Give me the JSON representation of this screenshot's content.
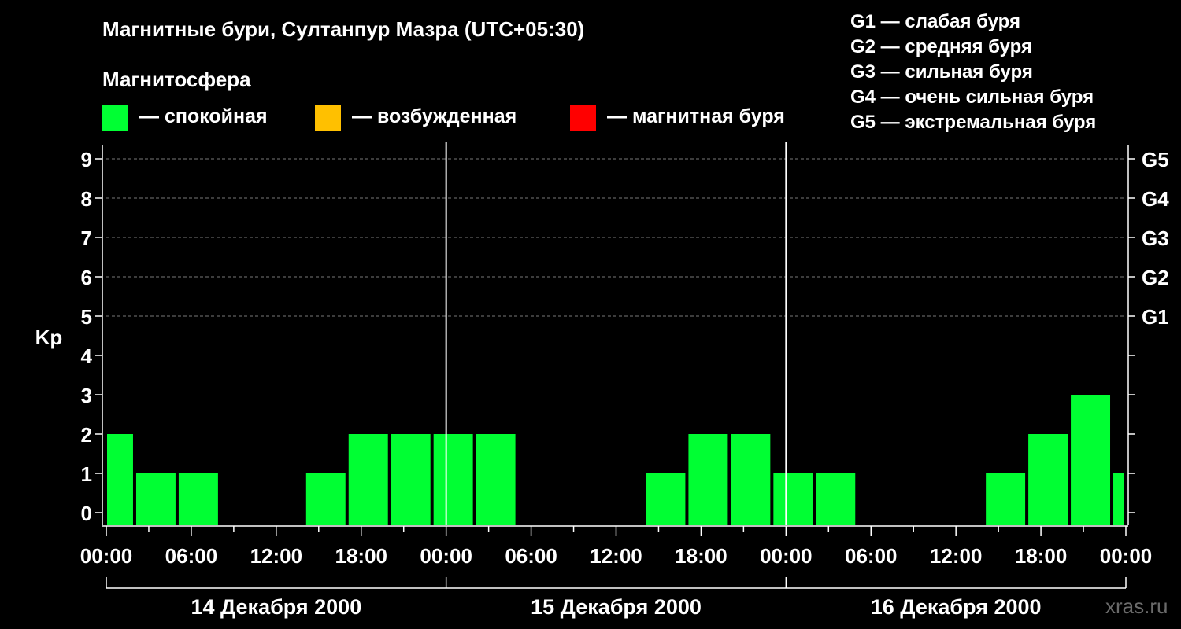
{
  "title": "Магнитные бури, Султанпур Мазра (UTC+05:30)",
  "magnetosphere": {
    "label": "Магнитосфера",
    "items": [
      {
        "color": "#00ff33",
        "text": "— спокойная"
      },
      {
        "color": "#ffc000",
        "text": "— возбужденная"
      },
      {
        "color": "#ff0000",
        "text": "— магнитная буря"
      }
    ]
  },
  "g_scale": [
    "G1 — слабая буря",
    "G2 — средняя буря",
    "G3 — сильная буря",
    "G4 — очень сильная буря",
    "G5 — экстремальная буря"
  ],
  "watermark": "xras.ru",
  "chart_data": {
    "type": "bar",
    "ylabel": "Kp",
    "ylim": [
      0,
      9
    ],
    "yticks": [
      0,
      1,
      2,
      3,
      4,
      5,
      6,
      7,
      8,
      9
    ],
    "right_labels": [
      {
        "kp": 5,
        "label": "G1"
      },
      {
        "kp": 6,
        "label": "G2"
      },
      {
        "kp": 7,
        "label": "G3"
      },
      {
        "kp": 8,
        "label": "G4"
      },
      {
        "kp": 9,
        "label": "G5"
      }
    ],
    "x_ticks": [
      "00:00",
      "06:00",
      "12:00",
      "18:00",
      "00:00",
      "06:00",
      "12:00",
      "18:00",
      "00:00",
      "06:00",
      "12:00",
      "18:00",
      "00:00"
    ],
    "days": [
      "14 Декабря 2000",
      "15 Декабря 2000",
      "16 Декабря 2000"
    ],
    "grid": true,
    "bar_color": "#00ff33",
    "bars": [
      {
        "start": "14 Dec 00:00",
        "end": "14 Dec 02:00",
        "kp": 2
      },
      {
        "start": "14 Dec 02:00",
        "end": "14 Dec 05:00",
        "kp": 1
      },
      {
        "start": "14 Dec 05:00",
        "end": "14 Dec 08:00",
        "kp": 1
      },
      {
        "start": "14 Dec 08:00",
        "end": "14 Dec 11:00",
        "kp": 0
      },
      {
        "start": "14 Dec 11:00",
        "end": "14 Dec 14:00",
        "kp": 0
      },
      {
        "start": "14 Dec 14:00",
        "end": "14 Dec 17:00",
        "kp": 1
      },
      {
        "start": "14 Dec 17:00",
        "end": "14 Dec 20:00",
        "kp": 2
      },
      {
        "start": "14 Dec 20:00",
        "end": "14 Dec 23:00",
        "kp": 2
      },
      {
        "start": "14 Dec 23:00",
        "end": "15 Dec 02:00",
        "kp": 2
      },
      {
        "start": "15 Dec 02:00",
        "end": "15 Dec 05:00",
        "kp": 2
      },
      {
        "start": "15 Dec 05:00",
        "end": "15 Dec 08:00",
        "kp": 0
      },
      {
        "start": "15 Dec 08:00",
        "end": "15 Dec 11:00",
        "kp": 0
      },
      {
        "start": "15 Dec 11:00",
        "end": "15 Dec 14:00",
        "kp": 0
      },
      {
        "start": "15 Dec 14:00",
        "end": "15 Dec 17:00",
        "kp": 1
      },
      {
        "start": "15 Dec 17:00",
        "end": "15 Dec 20:00",
        "kp": 2
      },
      {
        "start": "15 Dec 20:00",
        "end": "15 Dec 23:00",
        "kp": 2
      },
      {
        "start": "15 Dec 23:00",
        "end": "16 Dec 02:00",
        "kp": 1
      },
      {
        "start": "16 Dec 02:00",
        "end": "16 Dec 05:00",
        "kp": 1
      },
      {
        "start": "16 Dec 05:00",
        "end": "16 Dec 08:00",
        "kp": 0
      },
      {
        "start": "16 Dec 08:00",
        "end": "16 Dec 11:00",
        "kp": 0
      },
      {
        "start": "16 Dec 11:00",
        "end": "16 Dec 14:00",
        "kp": 0
      },
      {
        "start": "16 Dec 14:00",
        "end": "16 Dec 17:00",
        "kp": 1
      },
      {
        "start": "16 Dec 17:00",
        "end": "16 Dec 20:00",
        "kp": 2
      },
      {
        "start": "16 Dec 20:00",
        "end": "16 Dec 23:00",
        "kp": 3
      },
      {
        "start": "16 Dec 23:00",
        "end": "17 Dec 00:00",
        "kp": 1
      }
    ]
  }
}
